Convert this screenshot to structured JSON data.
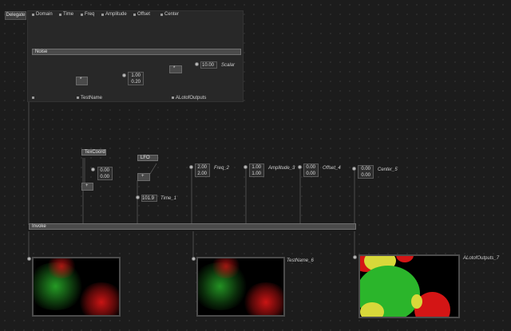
{
  "delegate": {
    "label": "Delegate"
  },
  "inputs": [
    {
      "label": "Domain"
    },
    {
      "label": "Time"
    },
    {
      "label": "Freq"
    },
    {
      "label": "Amplitude"
    },
    {
      "label": "Offset"
    },
    {
      "label": "Center"
    }
  ],
  "noise_node": {
    "label": "Noise"
  },
  "multiply_a": {
    "label": "*"
  },
  "multiply_b": {
    "label": "*"
  },
  "value_pair_a": {
    "v1": "1.00",
    "v2": "0.20"
  },
  "scalar": {
    "value": "10.00",
    "name": "Scalar"
  },
  "outputs": {
    "test_name": "TestName",
    "alot": "ALotofOutputs"
  },
  "texcoord": {
    "label": "TexCoord",
    "v1": "0.00",
    "v2": "0.00",
    "op": "+"
  },
  "lfo": {
    "label": "LFO",
    "op": "+",
    "time_value": "101.9",
    "time_name": "Time_1"
  },
  "freq": {
    "v1": "2.00",
    "v2": "2.00",
    "name": "Freq_2"
  },
  "amplitude": {
    "v1": "1.00",
    "v2": "1.00",
    "name": "Amplitude_3"
  },
  "offset": {
    "v1": "0.00",
    "v2": "0.00",
    "name": "Offset_4"
  },
  "center": {
    "v1": "0.00",
    "v2": "0.00",
    "name": "Center_5"
  },
  "invoke_node": {
    "label": "Invoke"
  },
  "previews": {
    "p2_name": "TestName_6",
    "p3_name": "ALotofOutputs_7"
  },
  "colors": {
    "background": "#1c1c1c",
    "node": "#4a4a4a",
    "green": "#2bb52b",
    "red": "#d41515",
    "yellow": "#d8d83a"
  }
}
